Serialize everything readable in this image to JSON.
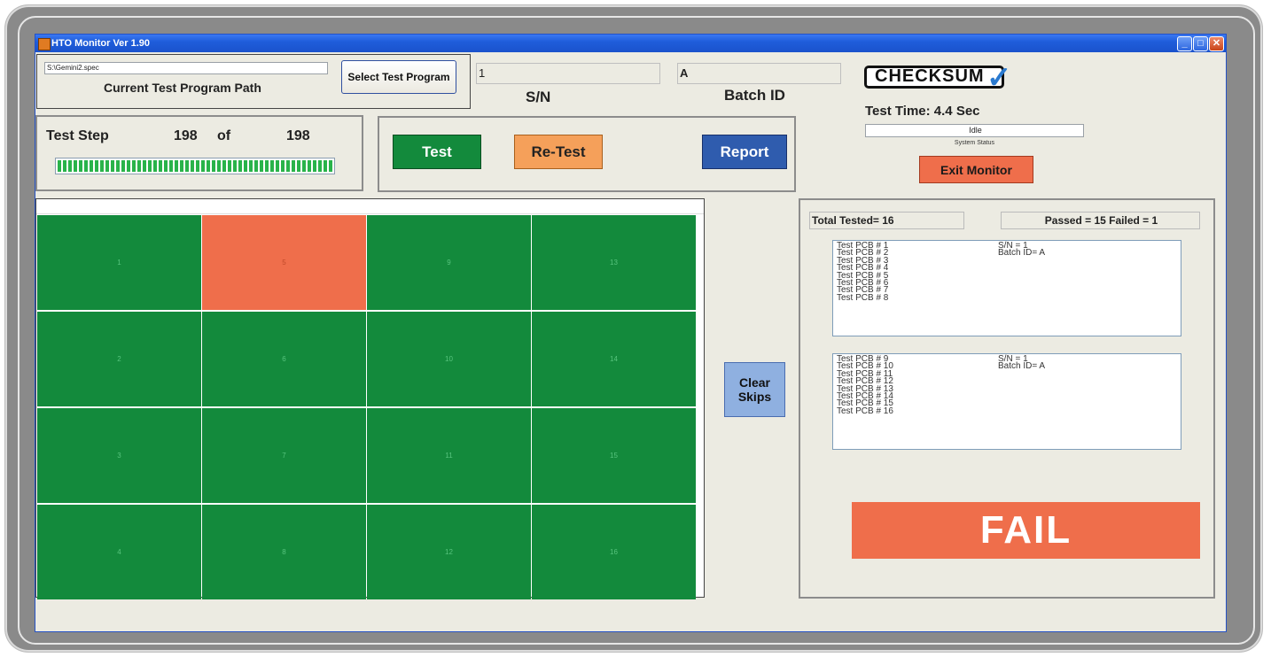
{
  "window": {
    "title": "HTO Monitor Ver 1.90",
    "minimize": "_",
    "maximize": "□",
    "close": "✕"
  },
  "program": {
    "path_value": "S:\\Gemini2.spec",
    "path_label": "Current Test Program Path",
    "select_button": "Select Test Program"
  },
  "serial": {
    "value": "1",
    "label": "S/N"
  },
  "batch": {
    "value": "A",
    "label": "Batch ID"
  },
  "logo": {
    "text": "CHECKSUM",
    "check": "✓"
  },
  "test_time": "Test Time: 4.4 Sec",
  "system": {
    "status_value": "Idle",
    "status_label": "System Status"
  },
  "exit_button": "Exit Monitor",
  "step": {
    "label": "Test Step",
    "current": "198",
    "of": "of",
    "total": "198",
    "progress_fraction": 1.0
  },
  "actions": {
    "test": "Test",
    "retest": "Re-Test",
    "report": "Report"
  },
  "clear_skips": "Clear Skips",
  "colors": {
    "pass": "#138a3c",
    "fail": "#ef6e4b",
    "retest": "#f5a05a",
    "report": "#2f5cae",
    "test": "#138a3c"
  },
  "grid": {
    "cells": [
      {
        "label": "1",
        "status": "pass"
      },
      {
        "label": "5",
        "status": "fail"
      },
      {
        "label": "9",
        "status": "pass"
      },
      {
        "label": "13",
        "status": "pass"
      },
      {
        "label": "2",
        "status": "pass"
      },
      {
        "label": "6",
        "status": "pass"
      },
      {
        "label": "10",
        "status": "pass"
      },
      {
        "label": "14",
        "status": "pass"
      },
      {
        "label": "3",
        "status": "pass"
      },
      {
        "label": "7",
        "status": "pass"
      },
      {
        "label": "11",
        "status": "pass"
      },
      {
        "label": "15",
        "status": "pass"
      },
      {
        "label": "4",
        "status": "pass"
      },
      {
        "label": "8",
        "status": "pass"
      },
      {
        "label": "12",
        "status": "pass"
      },
      {
        "label": "16",
        "status": "pass"
      }
    ]
  },
  "summary": {
    "total_tested": "Total Tested= 16",
    "passed_failed": "Passed = 15  Failed = 1"
  },
  "panel1": {
    "items": [
      "Test PCB # 1",
      "Test PCB # 2",
      "Test PCB # 3",
      "Test PCB # 4",
      "Test PCB # 5",
      "Test PCB # 6",
      "Test PCB # 7",
      "Test PCB # 8"
    ],
    "sn": "S/N =       1",
    "batch": "Batch ID=     A"
  },
  "panel2": {
    "items": [
      "Test PCB # 9",
      "Test PCB # 10",
      "Test PCB # 11",
      "Test PCB # 12",
      "Test PCB # 13",
      "Test PCB # 14",
      "Test PCB # 15",
      "Test PCB # 16"
    ],
    "sn": "S/N =       1",
    "batch": "Batch ID=     A"
  },
  "result": "FAIL"
}
